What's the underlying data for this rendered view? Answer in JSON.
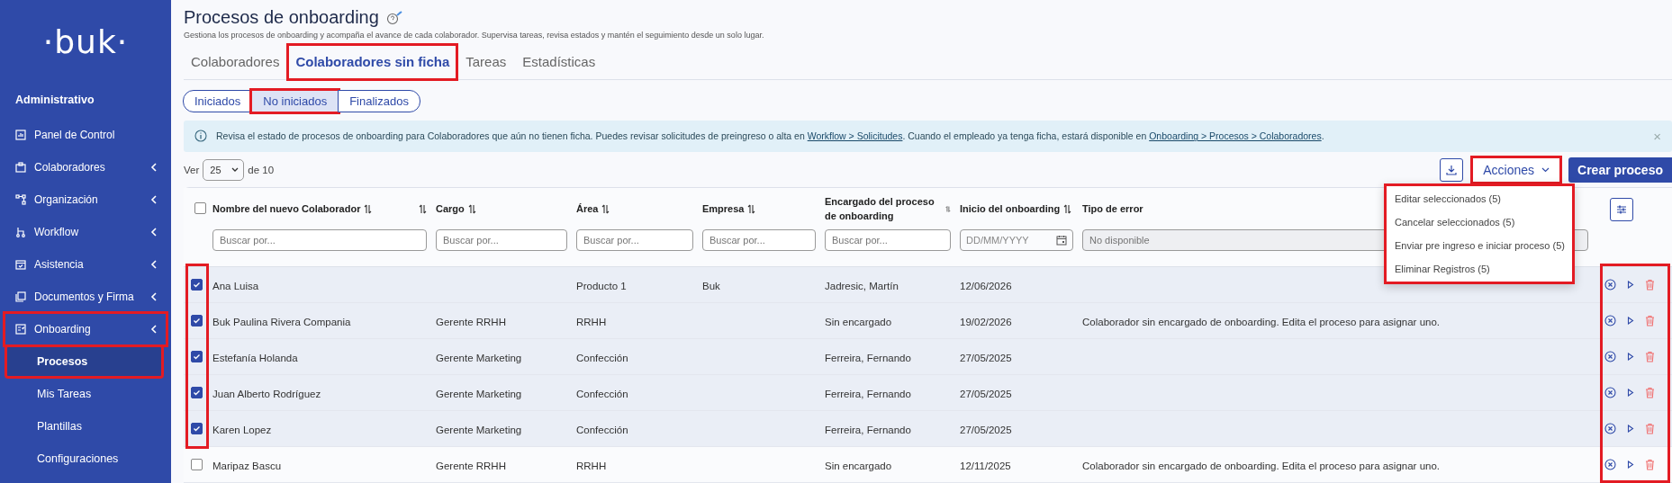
{
  "sidebar": {
    "logo": "·buk·",
    "section": "Administrativo",
    "items": [
      {
        "label": "Panel de Control",
        "expandable": false,
        "highlighted": false
      },
      {
        "label": "Colaboradores",
        "expandable": true,
        "highlighted": false
      },
      {
        "label": "Organización",
        "expandable": true,
        "highlighted": false
      },
      {
        "label": "Workflow",
        "expandable": true,
        "highlighted": false
      },
      {
        "label": "Asistencia",
        "expandable": true,
        "highlighted": false
      },
      {
        "label": "Documentos y Firma",
        "expandable": true,
        "highlighted": false
      },
      {
        "label": "Onboarding",
        "expandable": true,
        "highlighted": true,
        "children": [
          {
            "label": "Procesos",
            "selected": true,
            "highlighted": true
          },
          {
            "label": "Mis Tareas",
            "selected": false,
            "highlighted": false
          },
          {
            "label": "Plantillas",
            "selected": false,
            "highlighted": false
          },
          {
            "label": "Configuraciones",
            "selected": false,
            "highlighted": false
          }
        ]
      }
    ]
  },
  "header": {
    "title": "Procesos de onboarding",
    "subtitle": "Gestiona los procesos de onboarding y acompaña el avance de cada colaborador. Supervisa tareas, revisa estados y mantén el seguimiento desde un solo lugar."
  },
  "tabs": [
    {
      "label": "Colaboradores",
      "selected": false,
      "highlighted": false
    },
    {
      "label": "Colaboradores sin ficha",
      "selected": true,
      "highlighted": true
    },
    {
      "label": "Tareas",
      "selected": false,
      "highlighted": false
    },
    {
      "label": "Estadísticas",
      "selected": false,
      "highlighted": false
    }
  ],
  "filters": [
    {
      "label": "Iniciados",
      "selected": false,
      "highlighted": false
    },
    {
      "label": "No iniciados",
      "selected": true,
      "highlighted": true
    },
    {
      "label": "Finalizados",
      "selected": false,
      "highlighted": false
    }
  ],
  "banner": {
    "parts": [
      {
        "kind": "text",
        "text": "Revisa el estado de procesos de onboarding para Colaboradores que aún no tienen ficha. Puedes revisar solicitudes de preingreso o alta en "
      },
      {
        "kind": "link",
        "text": "Workflow > Solicitudes"
      },
      {
        "kind": "text",
        "text": ". Cuando el empleado ya tenga ficha, estará disponible en "
      },
      {
        "kind": "link",
        "text": "Onboarding > Procesos > Colaboradores"
      },
      {
        "kind": "text",
        "text": "."
      }
    ],
    "close": "×"
  },
  "pager": {
    "label": "Ver",
    "page_size": "25",
    "total": "de 10"
  },
  "toolbar": {
    "actions": {
      "label": "Acciones",
      "highlighted": true,
      "open": true,
      "menu": [
        "Editar seleccionados (5)",
        "Cancelar seleccionados (5)",
        "Enviar pre ingreso e iniciar proceso (5)",
        "Eliminar Registros (5)"
      ]
    },
    "create": "Crear proceso"
  },
  "table": {
    "all_selected": false,
    "checkbox_column_highlighted": true,
    "actions_column_highlighted": true,
    "columns": [
      {
        "label": "Nombre del nuevo Colaborador",
        "sortable": true,
        "extra_sort": true,
        "kind": "text",
        "placeholder": "Buscar por..."
      },
      {
        "label": "Cargo",
        "sortable": true,
        "kind": "text",
        "placeholder": "Buscar por..."
      },
      {
        "label": "Área",
        "sortable": true,
        "kind": "text",
        "placeholder": "Buscar por..."
      },
      {
        "label": "Empresa",
        "sortable": true,
        "kind": "text",
        "placeholder": "Buscar por..."
      },
      {
        "label": "Encargado del proceso de onboarding",
        "sortable": true,
        "kind": "text",
        "placeholder": "Buscar por..."
      },
      {
        "label": "Inicio del onboarding",
        "sortable": true,
        "kind": "date",
        "placeholder": "DD/MM/YYYY"
      },
      {
        "label": "Tipo de error",
        "sortable": false,
        "kind": "disabled",
        "placeholder": "No disponible"
      }
    ],
    "rows": [
      {
        "selected": true,
        "name": "Ana Luisa",
        "area": "Producto 1",
        "empresa": "Buk",
        "encargado": "Jadresic, Martín",
        "inicio": "12/06/2026"
      },
      {
        "selected": true,
        "name": "Buk Paulina Rivera Compania",
        "cargo": "Gerente RRHH",
        "area": "RRHH",
        "encargado": "Sin encargado",
        "inicio": "19/02/2026",
        "error": "Colaborador sin encargado de onboarding. Edita el proceso para asignar uno."
      },
      {
        "selected": true,
        "name": "Estefanía Holanda",
        "cargo": "Gerente Marketing",
        "area": "Confección",
        "encargado": "Ferreira, Fernando",
        "inicio": "27/05/2025"
      },
      {
        "selected": true,
        "name": "Juan Alberto Rodríguez",
        "cargo": "Gerente Marketing",
        "area": "Confección",
        "encargado": "Ferreira, Fernando",
        "inicio": "27/05/2025"
      },
      {
        "selected": true,
        "name": "Karen Lopez",
        "cargo": "Gerente Marketing",
        "area": "Confección",
        "encargado": "Ferreira, Fernando",
        "inicio": "27/05/2025"
      },
      {
        "selected": false,
        "name": "Maripaz Bascu",
        "cargo": "Gerente RRHH",
        "area": "RRHH",
        "encargado": "Sin encargado",
        "inicio": "12/11/2025",
        "error": "Colaborador sin encargado de onboarding. Edita el proceso para asignar uno."
      }
    ]
  }
}
